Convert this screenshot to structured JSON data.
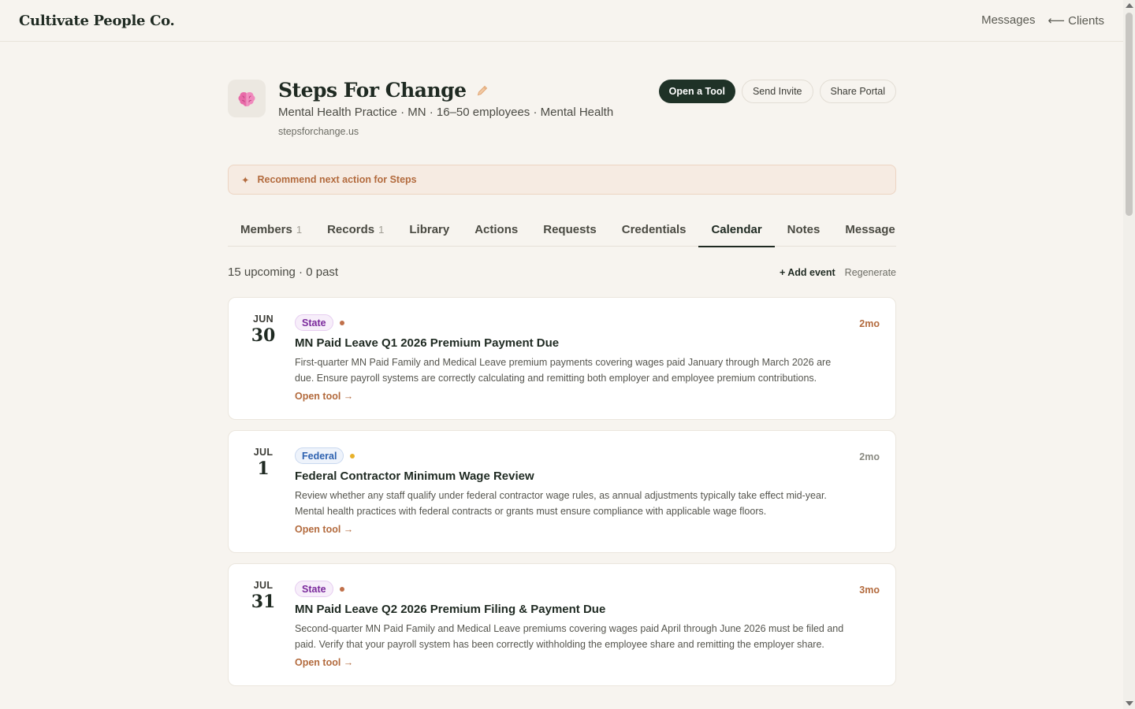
{
  "app": {
    "brand": "Cultivate People Co.",
    "nav": {
      "messages": "Messages",
      "clients": "⟵ Clients"
    }
  },
  "org": {
    "avatar_emoji": "🧠",
    "name": "Steps For Change",
    "meta": "Mental Health Practice · MN · 16–50 employees · Mental Health",
    "url": "stepsforchange.us",
    "actions": {
      "open_tool": "Open a Tool",
      "send_invite": "Send Invite",
      "share_portal": "Share Portal"
    }
  },
  "recommend": {
    "icon": "✦",
    "label": "Recommend next action for Steps"
  },
  "tabs": [
    {
      "label": "Members",
      "count": "1"
    },
    {
      "label": "Records",
      "count": "1"
    },
    {
      "label": "Library",
      "count": ""
    },
    {
      "label": "Actions",
      "count": ""
    },
    {
      "label": "Requests",
      "count": ""
    },
    {
      "label": "Credentials",
      "count": ""
    },
    {
      "label": "Calendar",
      "count": "",
      "active": true
    },
    {
      "label": "Notes",
      "count": ""
    },
    {
      "label": "Message",
      "count": ""
    }
  ],
  "calendar": {
    "summary": "15 upcoming · 0 past",
    "add_event": "+ Add event",
    "regenerate": "Regenerate",
    "events": [
      {
        "month": "JUN",
        "day": "30",
        "tag": "State",
        "title": "MN Paid Leave Q1 2026 Premium Payment Due",
        "description": "First-quarter MN Paid Family and Medical Leave premium payments covering wages paid January through March 2026 are due. Ensure payroll systems are correctly calculating and remitting both employer and employee premium contributions.",
        "link": "Open tool →",
        "relative": "2mo"
      },
      {
        "month": "JUL",
        "day": "1",
        "tag": "Federal",
        "title": "Federal Contractor Minimum Wage Review",
        "description": "Review whether any staff qualify under federal contractor wage rules, as annual adjustments typically take effect mid-year. Mental health practices with federal contracts or grants must ensure compliance with applicable wage floors.",
        "link": "Open tool →",
        "relative": "2mo"
      },
      {
        "month": "JUL",
        "day": "31",
        "tag": "State",
        "title": "MN Paid Leave Q2 2026 Premium Filing & Payment Due",
        "description": "Second-quarter MN Paid Family and Medical Leave premiums covering wages paid April through June 2026 must be filed and paid. Verify that your payroll system has been correctly withholding the employee share and remitting the employer share.",
        "link": "Open tool →",
        "relative": "3mo"
      }
    ]
  },
  "colors": {
    "tag_state_dot": "#c0704a",
    "tag_federal_dot": "#e8b12a",
    "relative_accent": "#b36b3e",
    "relative_muted": "#8a8a82"
  }
}
